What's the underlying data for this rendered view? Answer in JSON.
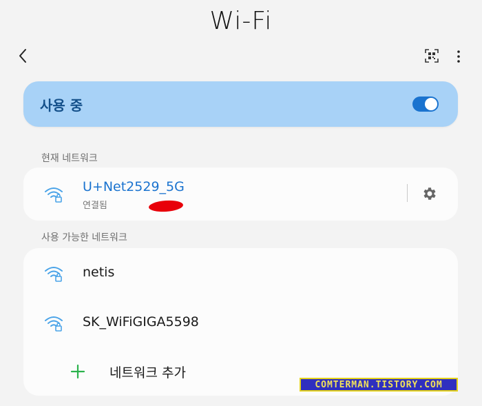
{
  "header": {
    "title": "Wi-Fi"
  },
  "toggle": {
    "label": "사용 중",
    "state": "on"
  },
  "current_network": {
    "section_title": "현재 네트워크",
    "name": "U+Net2529_5G",
    "status": "연결됨"
  },
  "available_networks": {
    "section_title": "사용 가능한 네트워크",
    "items": [
      {
        "name": "netis"
      },
      {
        "name": "SK_WiFiGIGA5598"
      }
    ],
    "add_label": "네트워크 추가"
  },
  "watermark": {
    "text": "COMTERMAN.TISTORY.COM"
  },
  "colors": {
    "background": "#f3f3f3",
    "toggle_card": "#a8d2f7",
    "toggle_text": "#14508a",
    "accent_blue": "#1a73cf",
    "add_green": "#2bb24c",
    "wifi_icon": "#4aa3e8"
  }
}
